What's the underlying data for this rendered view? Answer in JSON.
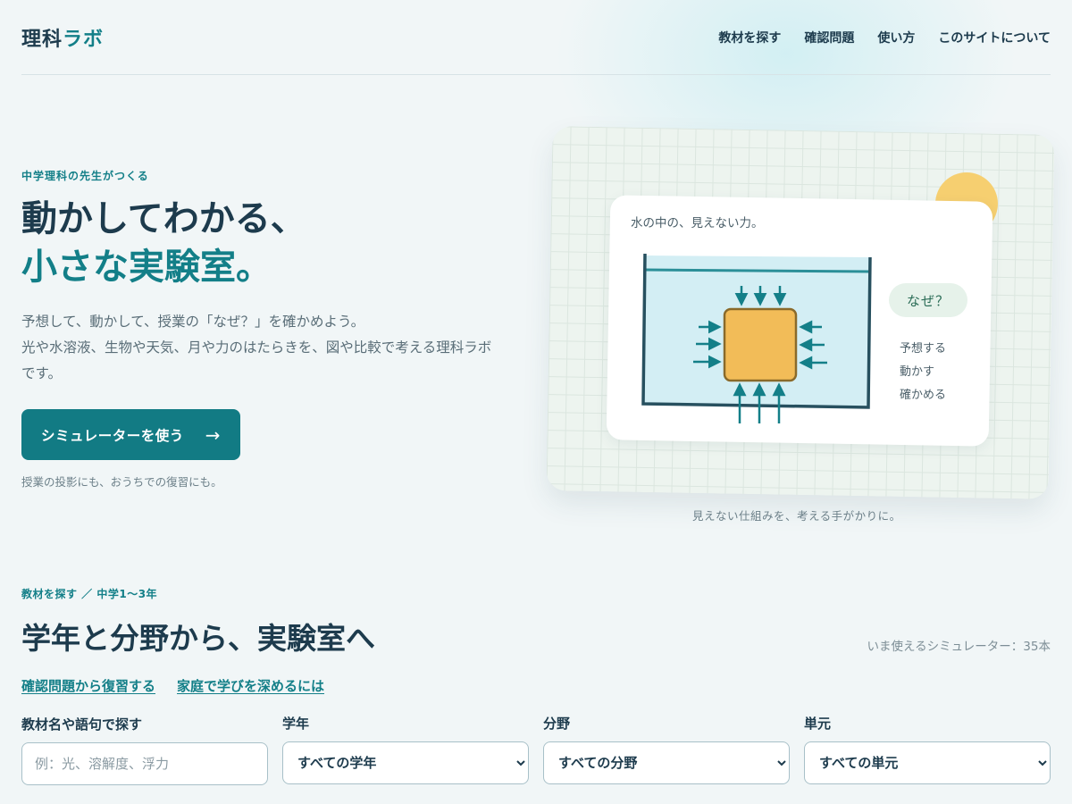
{
  "header": {
    "logo_main": "理科",
    "logo_accent": "ラボ",
    "nav": [
      "教材を探す",
      "確認問題",
      "使い方",
      "このサイトについて"
    ]
  },
  "hero": {
    "eyebrow": "中学理科の先生がつくる",
    "title_line1": "動かしてわかる、",
    "title_line2": "小さな実験室。",
    "description_line1": "予想して、動かして、授業の「なぜ？」を確かめよう。",
    "description_line2": "光や水溶液、生物や天気、月や力のはたらきを、図や比較で考える理科ラボです。",
    "cta_label": "シミュレーターを使う",
    "cta_arrow": "→",
    "cta_note": "授業の投影にも、おうちでの復習にも。"
  },
  "illustration": {
    "card_title": "水の中の、見えない力。",
    "bubble": "なぜ？",
    "steps": [
      "予想する",
      "動かす",
      "確かめる"
    ],
    "caption": "見えない仕組みを、考える手がかりに。"
  },
  "search": {
    "eyebrow": "教材を探す ／ 中学1〜3年",
    "title": "学年と分野から、実験室へ",
    "count": "いま使えるシミュレーター：35本",
    "links": [
      "確認問題から復習する",
      "家庭で学びを深めるには"
    ],
    "keyword_label": "教材名や語句で探す",
    "keyword_placeholder": "例：光、溶解度、浮力",
    "grade_label": "学年",
    "grade_value": "すべての学年",
    "field_label": "分野",
    "field_value": "すべての分野",
    "unit_label": "単元",
    "unit_value": "すべての単元"
  },
  "colors": {
    "accent": "#137f88",
    "text": "#1d3b4d",
    "cta": "#127b84",
    "sun": "#f6cf70",
    "block": "#f2bc58",
    "water": "#d3eef4"
  }
}
